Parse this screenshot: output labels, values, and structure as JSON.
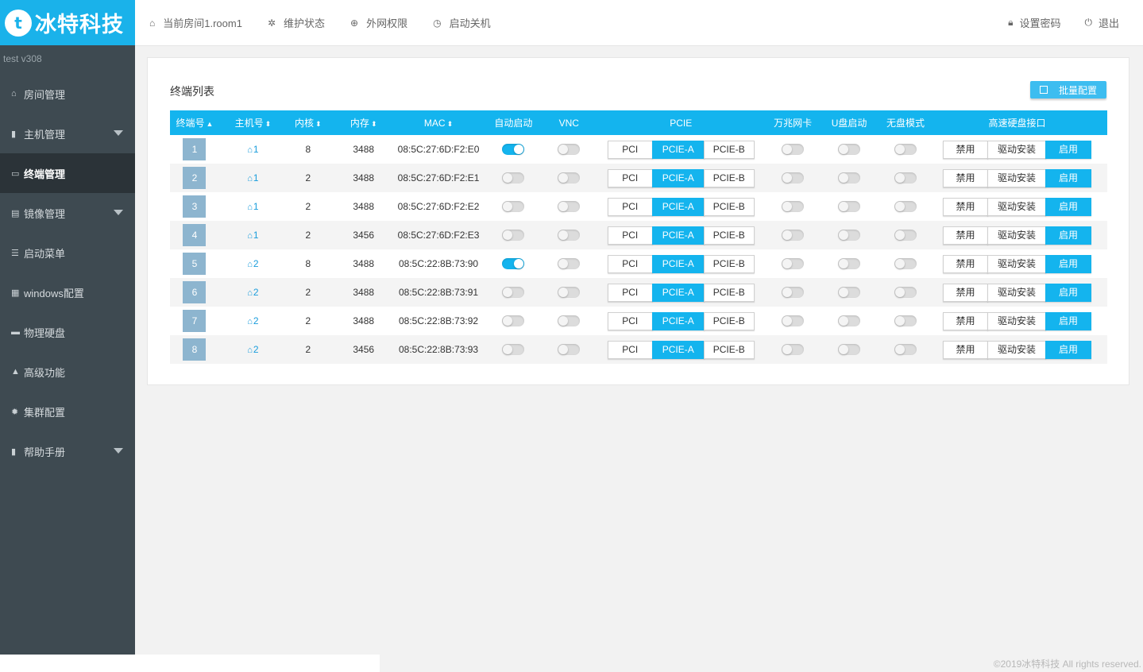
{
  "brand": {
    "mark": "t",
    "name": "冰特科技"
  },
  "topbar": {
    "nav": [
      {
        "icon": "home-icon",
        "glyph": "⌂",
        "label": "当前房间1.room1"
      },
      {
        "icon": "wrench-icon",
        "glyph": "✲",
        "label": "维护状态"
      },
      {
        "icon": "globe-icon",
        "glyph": "⊕",
        "label": "外网权限"
      },
      {
        "icon": "clock-icon",
        "glyph": "◷",
        "label": "启动关机"
      }
    ],
    "right": [
      {
        "icon": "lock-icon",
        "glyph": "🔒︎",
        "label": "设置密码"
      },
      {
        "icon": "power-icon",
        "glyph": "⏻",
        "label": "退出"
      }
    ]
  },
  "sidebar": {
    "version": "test  v308",
    "items": [
      {
        "label": "房间管理",
        "glyph": "⌂",
        "icon": "home-icon",
        "active": false,
        "caret": false
      },
      {
        "label": "主机管理",
        "glyph": "▮",
        "icon": "server-icon",
        "active": false,
        "caret": true
      },
      {
        "label": "终端管理",
        "glyph": "▭",
        "icon": "monitor-icon",
        "active": true,
        "caret": false
      },
      {
        "label": "镜像管理",
        "glyph": "▤",
        "icon": "database-icon",
        "active": false,
        "caret": true
      },
      {
        "label": "启动菜单",
        "glyph": "☰",
        "icon": "list-icon",
        "active": false,
        "caret": false
      },
      {
        "label": "windows配置",
        "glyph": "▦",
        "icon": "windows-icon",
        "active": false,
        "caret": false
      },
      {
        "label": "物理硬盘",
        "glyph": "▬",
        "icon": "harddisk-icon",
        "active": false,
        "caret": false
      },
      {
        "label": "高级功能",
        "glyph": "▲",
        "icon": "warning-icon",
        "active": false,
        "caret": false
      },
      {
        "label": "集群配置",
        "glyph": "✹",
        "icon": "gear-icon",
        "active": false,
        "caret": false
      },
      {
        "label": "帮助手册",
        "glyph": "▮",
        "icon": "book-icon",
        "active": false,
        "caret": true
      }
    ]
  },
  "panel": {
    "title": "终端列表",
    "batch_button": "批量配置",
    "columns": [
      "终端号",
      "主机号",
      "内核",
      "内存",
      "MAC",
      "自动启动",
      "VNC",
      "PCIE",
      "万兆网卡",
      "U盘启动",
      "无盘模式",
      "高速硬盘接口"
    ],
    "sort": {
      "终端号": "▲",
      "主机号": "⬍",
      "内核": "⬍",
      "内存": "⬍",
      "MAC": "⬍"
    },
    "pcie_options": [
      "PCI",
      "PCIE-A",
      "PCIE-B"
    ],
    "hd_options": [
      "禁用",
      "驱动安装",
      "启用"
    ],
    "rows": [
      {
        "term": "1",
        "host": "1",
        "cores": "8",
        "mem": "3488",
        "mac": "08:5C:27:6D:F2:E0",
        "auto": true,
        "vnc": false,
        "pcie": 1,
        "tengig": false,
        "usb": false,
        "diskless": false,
        "hd": 2
      },
      {
        "term": "2",
        "host": "1",
        "cores": "2",
        "mem": "3488",
        "mac": "08:5C:27:6D:F2:E1",
        "auto": false,
        "vnc": false,
        "pcie": 1,
        "tengig": false,
        "usb": false,
        "diskless": false,
        "hd": 2
      },
      {
        "term": "3",
        "host": "1",
        "cores": "2",
        "mem": "3488",
        "mac": "08:5C:27:6D:F2:E2",
        "auto": false,
        "vnc": false,
        "pcie": 1,
        "tengig": false,
        "usb": false,
        "diskless": false,
        "hd": 2
      },
      {
        "term": "4",
        "host": "1",
        "cores": "2",
        "mem": "3456",
        "mac": "08:5C:27:6D:F2:E3",
        "auto": false,
        "vnc": false,
        "pcie": 1,
        "tengig": false,
        "usb": false,
        "diskless": false,
        "hd": 2
      },
      {
        "term": "5",
        "host": "2",
        "cores": "8",
        "mem": "3488",
        "mac": "08:5C:22:8B:73:90",
        "auto": true,
        "vnc": false,
        "pcie": 1,
        "tengig": false,
        "usb": false,
        "diskless": false,
        "hd": 2
      },
      {
        "term": "6",
        "host": "2",
        "cores": "2",
        "mem": "3488",
        "mac": "08:5C:22:8B:73:91",
        "auto": false,
        "vnc": false,
        "pcie": 1,
        "tengig": false,
        "usb": false,
        "diskless": false,
        "hd": 2
      },
      {
        "term": "7",
        "host": "2",
        "cores": "2",
        "mem": "3488",
        "mac": "08:5C:22:8B:73:92",
        "auto": false,
        "vnc": false,
        "pcie": 1,
        "tengig": false,
        "usb": false,
        "diskless": false,
        "hd": 2
      },
      {
        "term": "8",
        "host": "2",
        "cores": "2",
        "mem": "3456",
        "mac": "08:5C:22:8B:73:93",
        "auto": false,
        "vnc": false,
        "pcie": 1,
        "tengig": false,
        "usb": false,
        "diskless": false,
        "hd": 2
      }
    ]
  },
  "footer": "©2019冰特科技 All rights reserved.",
  "colors": {
    "accent": "#14b4ee",
    "sidebar": "#3e4a51",
    "sidebar_active": "#2b3338",
    "term_badge": "#8db5cf"
  }
}
